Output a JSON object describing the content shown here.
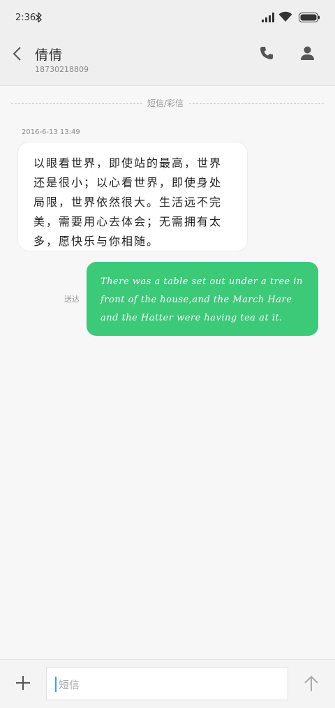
{
  "status_bar": {
    "time": "2:36",
    "icons": [
      "bluetooth-icon",
      "signal-icon",
      "wifi-icon",
      "battery-icon"
    ]
  },
  "header": {
    "contact_name": "倩倩",
    "contact_number": "18730218809",
    "icons": [
      "back-icon",
      "call-icon",
      "person-icon"
    ]
  },
  "conversation": {
    "divider_label": "短信/彩信",
    "timestamp": "2016-6-13 13:49",
    "incoming_message": "以眼看世界，即使站的最高，世界还是很小；以心看世界，即使身处局限，世界依然很大。生活远不完美，需要用心去体会；无需拥有太多，愿快乐与你相随。",
    "outgoing_message": "There was a table set out under a tree in front of the house,and the March Hare and the Hatter were having tea at it.",
    "outgoing_status": "送达"
  },
  "composer": {
    "placeholder": "短信",
    "icons": [
      "plus-icon",
      "send-arrow-icon"
    ]
  },
  "colors": {
    "outgoing_bubble": "#3cc978",
    "incoming_bubble": "#ffffff",
    "background": "#f7f7f7",
    "cursor": "#3aa0f0"
  }
}
